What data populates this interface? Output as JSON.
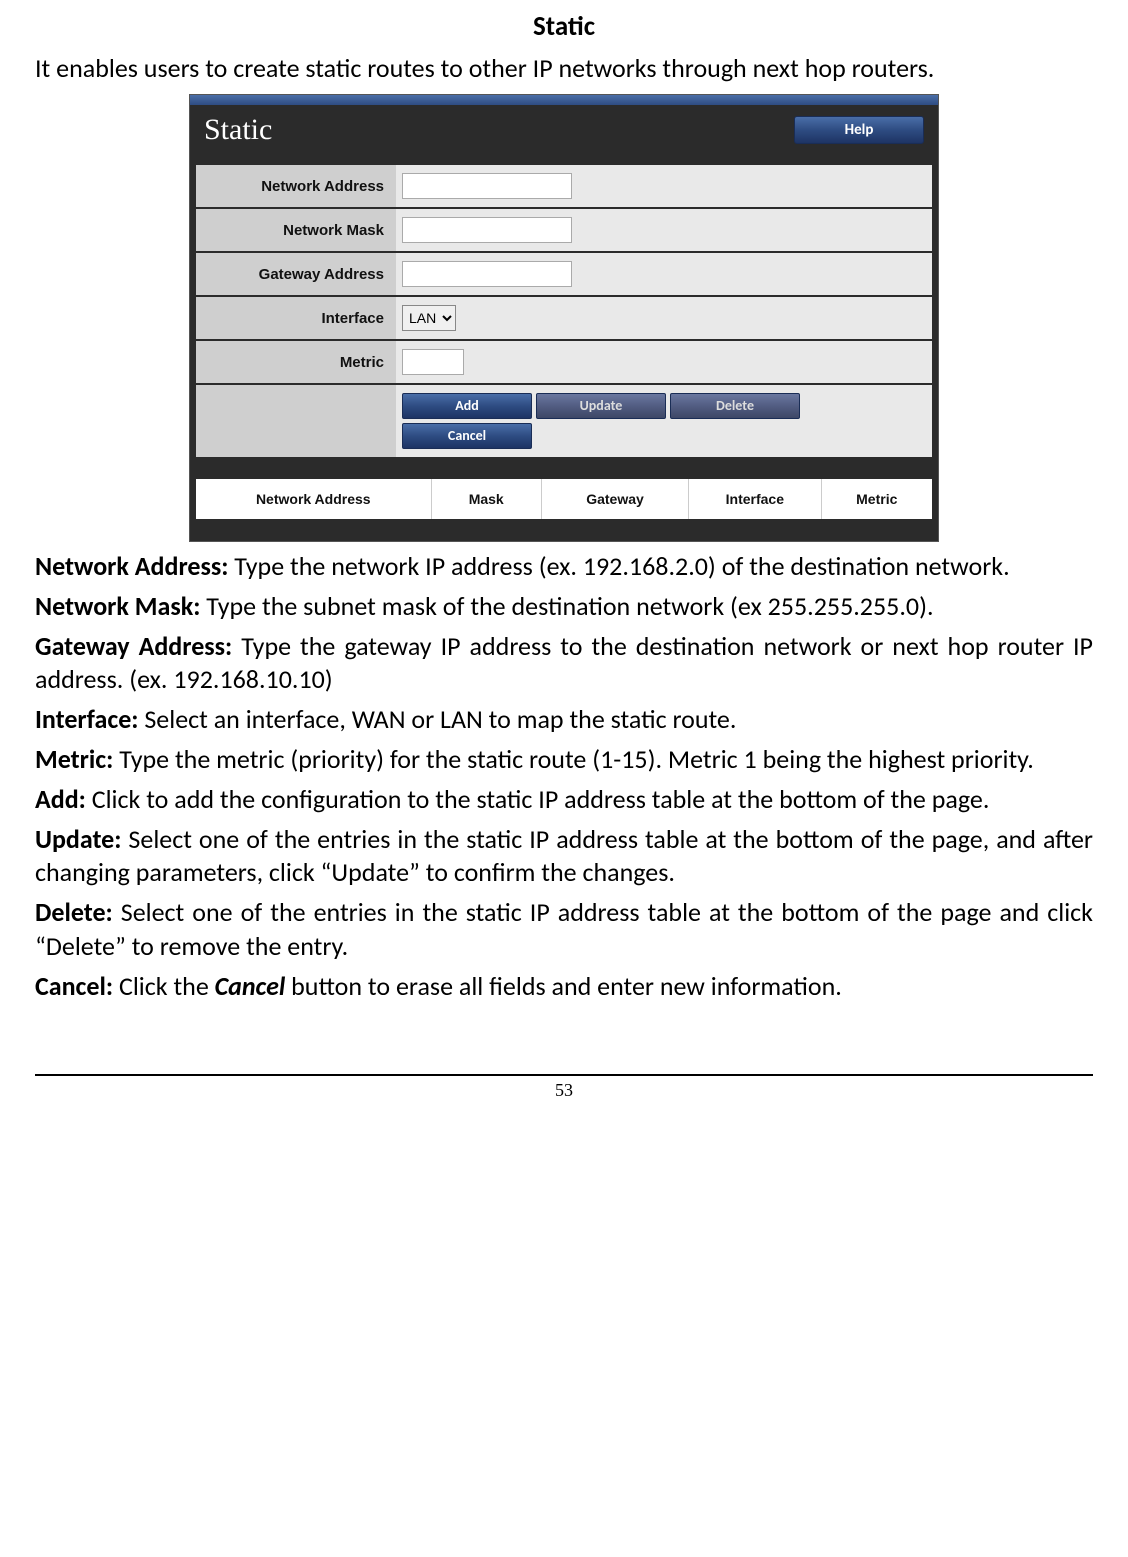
{
  "title": "Static",
  "intro": "It enables users to create static routes to other IP networks through next hop routers.",
  "ui": {
    "panel_title": "Static",
    "help": "Help",
    "fields": {
      "network_address": "Network Address",
      "network_mask": "Network Mask",
      "gateway_address": "Gateway Address",
      "interface": "Interface",
      "interface_value": "LAN",
      "metric": "Metric"
    },
    "buttons": {
      "add": "Add",
      "update": "Update",
      "delete": "Delete",
      "cancel": "Cancel"
    },
    "table_headers": {
      "addr": "Network Address",
      "mask": "Mask",
      "gw": "Gateway",
      "iface": "Interface",
      "metric": "Metric"
    }
  },
  "desc": {
    "network_address_label": "Network Address:",
    "network_address_text": " Type the network IP address (ex. 192.168.2.0) of the destination network.",
    "network_mask_label": "Network Mask:",
    "network_mask_text": " Type the subnet mask of the destination network (ex 255.255.255.0).",
    "gateway_address_label": "Gateway Address:",
    "gateway_address_text": " Type the gateway IP address to the destination network or next hop router IP address. (ex. 192.168.10.10)",
    "interface_label": "Interface:",
    "interface_text": " Select an interface, WAN or LAN to map the static route.",
    "metric_label": "Metric:",
    "metric_text": " Type the metric (priority) for the static route (1-15). Metric 1 being the highest priority.",
    "add_label": "Add:",
    "add_text": " Click to add the configuration to the static IP address table at the bottom of the page.",
    "update_label": "Update:",
    "update_text": " Select one of the entries in the static IP address table at the bottom of the page, and after changing parameters, click “Update” to confirm the changes.",
    "delete_label": "Delete:",
    "delete_text": " Select one of the entries in the static IP address table at the bottom of the page and click “Delete” to remove the entry.",
    "cancel_label": "Cancel:",
    "cancel_text_a": " Click the ",
    "cancel_text_b": "Cancel",
    "cancel_text_c": " button to erase all fields and enter new information."
  },
  "page_number": "53"
}
